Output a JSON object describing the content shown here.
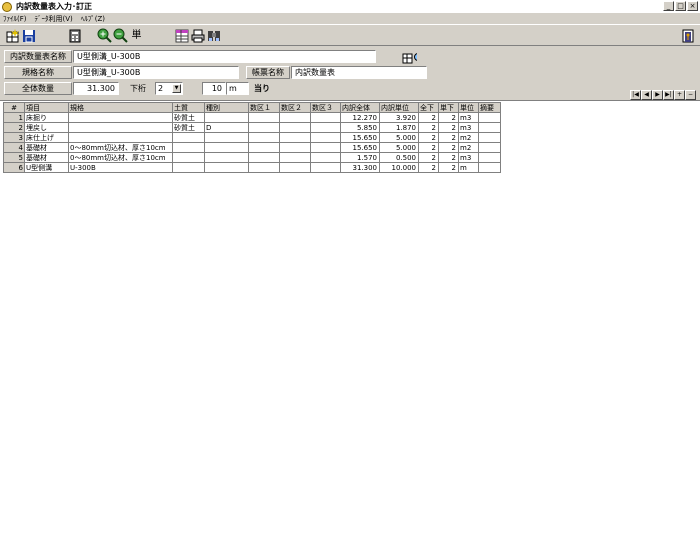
{
  "window": {
    "title": "内訳数量表入力･訂正",
    "min": "_",
    "max": "□",
    "close": "×"
  },
  "menu": [
    "ﾌｧｲﾙ(F)",
    "ﾃﾞｰﾀ利用(V)",
    "ﾍﾙﾌﾟ(Z)"
  ],
  "toolbar": {
    "unit_button_label": "単"
  },
  "form": {
    "table_name_label": "内訳数量表名称",
    "table_name_value": "U型側溝_U-300B",
    "spec_name_label": "規格名称",
    "spec_name_value": "U型側溝_U-300B",
    "form_name_label": "帳票名称",
    "form_name_value": "内訳数量表",
    "total_label": "全体数量",
    "total_value": "31.300",
    "decimal_label": "下桁",
    "decimal_value": "2",
    "per_value": "10",
    "per_unit": "m",
    "per_suffix": "当り"
  },
  "nav": [
    "|◀",
    "◀",
    "▶",
    "▶|",
    "+",
    "−"
  ],
  "table": {
    "headers": [
      "#",
      "項目",
      "規格",
      "土質",
      "種別",
      "数区１",
      "数区２",
      "数区３",
      "内訳全体",
      "内訳単位",
      "全下",
      "単下",
      "単位",
      "摘要"
    ],
    "rows": [
      {
        "num": "1",
        "item": "床掘り",
        "spec": "",
        "soil": "砂質土",
        "kind": "",
        "c1": "",
        "c2": "",
        "c3": "",
        "total": "12.270",
        "unit_qty": "3.920",
        "d1": "2",
        "d2": "2",
        "unit": "m3",
        "note": ""
      },
      {
        "num": "2",
        "item": "埋戻し",
        "spec": "",
        "soil": "砂質土",
        "kind": "D",
        "c1": "",
        "c2": "",
        "c3": "",
        "total": "5.850",
        "unit_qty": "1.870",
        "d1": "2",
        "d2": "2",
        "unit": "m3",
        "note": ""
      },
      {
        "num": "3",
        "item": "床仕上げ",
        "spec": "",
        "soil": "",
        "kind": "",
        "c1": "",
        "c2": "",
        "c3": "",
        "total": "15.650",
        "unit_qty": "5.000",
        "d1": "2",
        "d2": "2",
        "unit": "m2",
        "note": ""
      },
      {
        "num": "4",
        "item": "基礎材",
        "spec": "0～80mm切込材、厚さ10cm",
        "soil": "",
        "kind": "",
        "c1": "",
        "c2": "",
        "c3": "",
        "total": "15.650",
        "unit_qty": "5.000",
        "d1": "2",
        "d2": "2",
        "unit": "m2",
        "note": ""
      },
      {
        "num": "5",
        "item": "基礎材",
        "spec": "0～80mm切込材、厚さ10cm",
        "soil": "",
        "kind": "",
        "c1": "",
        "c2": "",
        "c3": "",
        "total": "1.570",
        "unit_qty": "0.500",
        "d1": "2",
        "d2": "2",
        "unit": "m3",
        "note": ""
      },
      {
        "num": "6",
        "item": "U型側溝",
        "spec": "U-300B",
        "soil": "",
        "kind": "",
        "c1": "",
        "c2": "",
        "c3": "",
        "total": "31.300",
        "unit_qty": "10.000",
        "d1": "2",
        "d2": "2",
        "unit": "m",
        "note": ""
      }
    ]
  }
}
